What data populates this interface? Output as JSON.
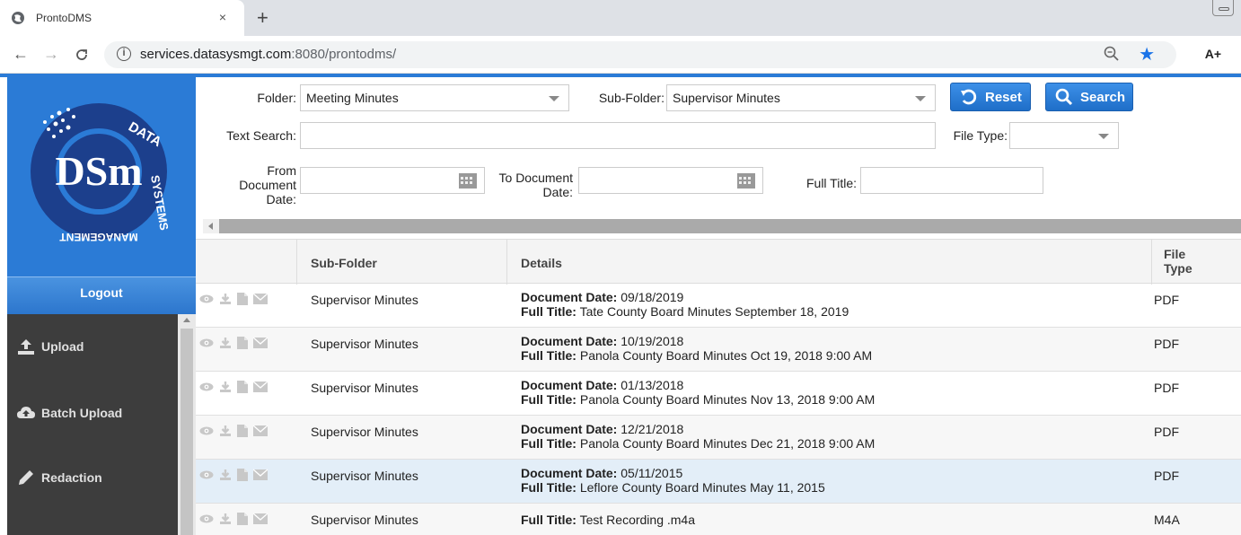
{
  "browser": {
    "tab_title": "ProntoDMS",
    "tab_close": "×",
    "new_tab": "+",
    "url_host": "services.datasysmgt.com",
    "url_path": ":8080/prontodms/",
    "reader_btn": "A+"
  },
  "sidebar": {
    "logout": "Logout",
    "items": [
      {
        "label": "Upload"
      },
      {
        "label": "Batch Upload"
      },
      {
        "label": "Redaction"
      }
    ]
  },
  "form": {
    "folder_label": "Folder:",
    "folder_value": "Meeting Minutes",
    "subfolder_label": "Sub-Folder:",
    "subfolder_value": "Supervisor Minutes",
    "reset_label": "Reset",
    "search_label": "Search",
    "text_search_label": "Text Search:",
    "text_search_value": "",
    "file_type_label": "File Type:",
    "file_type_value": "",
    "from_date_label_1": "From",
    "from_date_label_2": "Document",
    "from_date_label_3": "Date:",
    "to_date_label_1": "To Document",
    "to_date_label_2": "Date:",
    "full_title_label": "Full Title:"
  },
  "table": {
    "headers": {
      "subfolder": "Sub-Folder",
      "details": "Details",
      "filetype_1": "File",
      "filetype_2": "Type"
    },
    "date_key": "Document Date:",
    "title_key": "Full Title:",
    "rows": [
      {
        "subfolder": "Supervisor Minutes",
        "date": "09/18/2019",
        "title": "Tate County Board Minutes September 18, 2019",
        "filetype": "PDF"
      },
      {
        "subfolder": "Supervisor Minutes",
        "date": "10/19/2018",
        "title": "Panola County Board Minutes Oct 19, 2018 9:00 AM",
        "filetype": "PDF"
      },
      {
        "subfolder": "Supervisor Minutes",
        "date": "01/13/2018",
        "title": "Panola County Board Minutes Nov 13, 2018 9:00 AM",
        "filetype": "PDF"
      },
      {
        "subfolder": "Supervisor Minutes",
        "date": "12/21/2018",
        "title": "Panola County Board Minutes Dec 21, 2018 9:00 AM",
        "filetype": "PDF"
      },
      {
        "subfolder": "Supervisor Minutes",
        "date": "05/11/2015",
        "title": "Leflore County Board Minutes May 11, 2015",
        "filetype": "PDF"
      },
      {
        "subfolder": "Supervisor Minutes",
        "date": "",
        "title": "Test Recording .m4a",
        "filetype": "M4A"
      }
    ]
  },
  "colors": {
    "brand_blue": "#2b7bd6",
    "menu_bg": "#3d3d3d",
    "highlight_row": "#e3eef8"
  }
}
